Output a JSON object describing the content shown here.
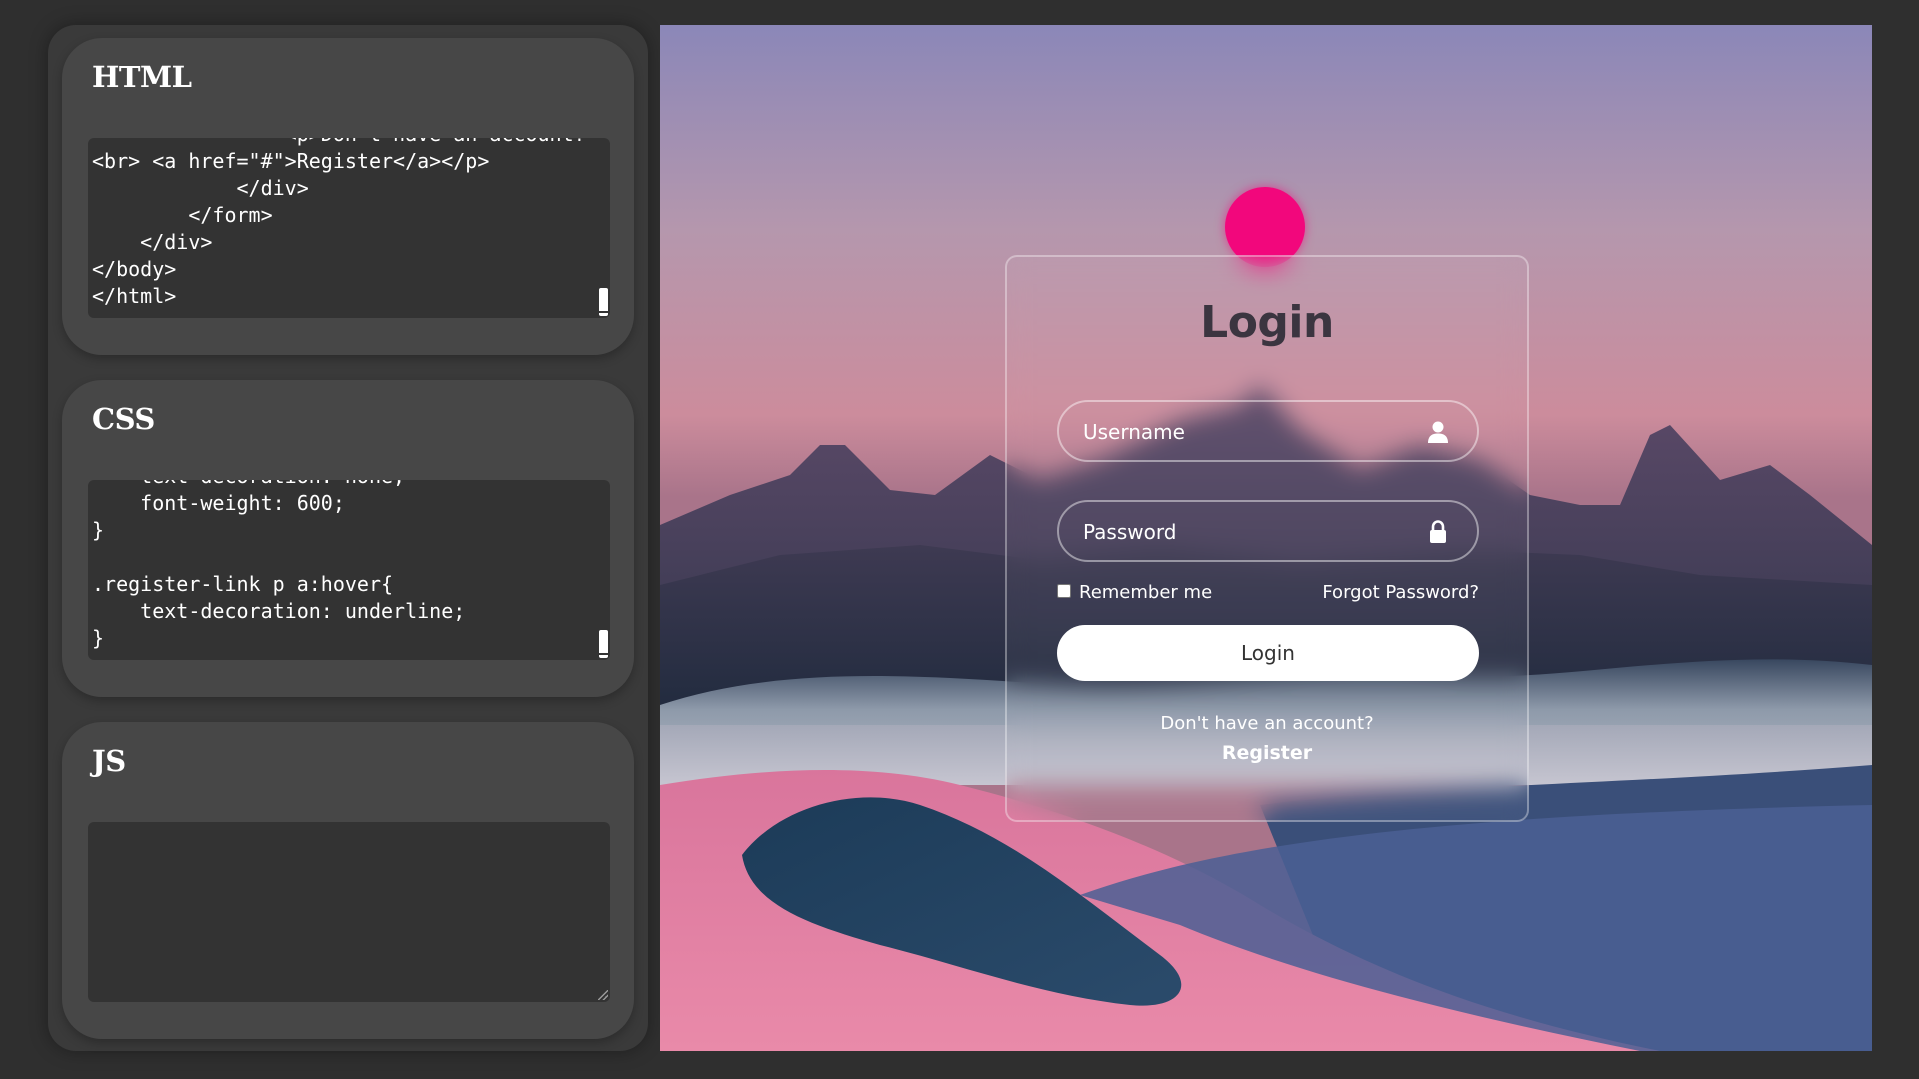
{
  "editors": [
    {
      "title": "HTML",
      "code": "                <p>Don't have an account?\n<br> <a href=\"#\">Register</a></p>\n            </div>\n        </form>\n    </div>\n</body>\n</html>"
    },
    {
      "title": "CSS",
      "code": "    text-decoration: none;\n    font-weight: 600;\n}\n\n.register-link p a:hover{\n    text-decoration: underline;\n}"
    },
    {
      "title": "JS",
      "code": ""
    }
  ],
  "login": {
    "title": "Login",
    "username_placeholder": "Username",
    "username_icon": "user-icon",
    "password_placeholder": "Password",
    "password_icon": "lock-icon",
    "remember_label": "Remember me",
    "forgot_label": "Forgot Password?",
    "button_label": "Login",
    "register_question": "Don't have an account?",
    "register_label": "Register",
    "accent_color": "#f2077c"
  }
}
